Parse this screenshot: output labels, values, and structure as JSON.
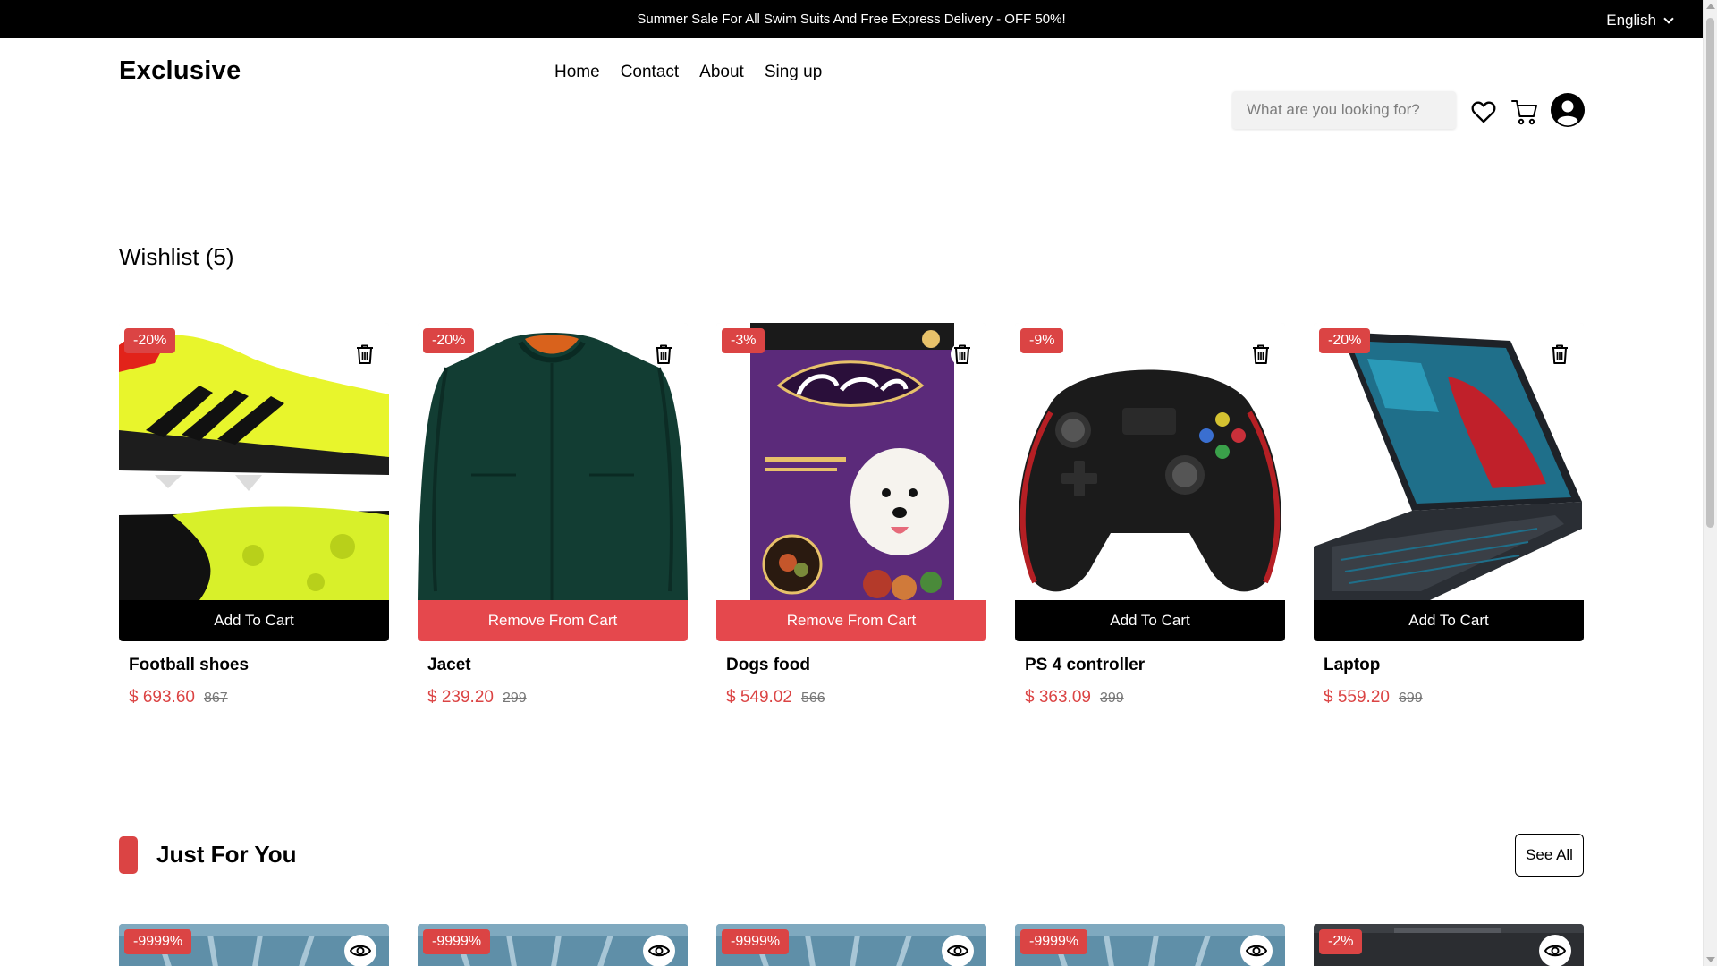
{
  "topbar": {
    "promo": "Summer Sale For All Swim Suits And Free Express Delivery - OFF 50%!",
    "language": "English"
  },
  "header": {
    "logo": "Exclusive",
    "nav": [
      "Home",
      "Contact",
      "About",
      "Sing up"
    ],
    "search_placeholder": "What are you looking for?"
  },
  "wishlist": {
    "title": "Wishlist (5)",
    "items": [
      {
        "discount": "-20%",
        "action": "Add To Cart",
        "action_style": "black",
        "name": "Football shoes",
        "price": "$ 693.60",
        "old_price": "867",
        "image": "football-shoes"
      },
      {
        "discount": "-20%",
        "action": "Remove From Cart",
        "action_style": "red",
        "name": "Jacet",
        "price": "$ 239.20",
        "old_price": "299",
        "image": "jacket"
      },
      {
        "discount": "-3%",
        "action": "Remove From Cart",
        "action_style": "red",
        "name": "Dogs food",
        "price": "$ 549.02",
        "old_price": "566",
        "image": "dog-food"
      },
      {
        "discount": "-9%",
        "action": "Add To Cart",
        "action_style": "black",
        "name": "PS 4 controller",
        "price": "$ 363.09",
        "old_price": "399",
        "image": "controller"
      },
      {
        "discount": "-20%",
        "action": "Add To Cart",
        "action_style": "black",
        "name": "Laptop",
        "price": "$ 559.20",
        "old_price": "699",
        "image": "laptop"
      }
    ]
  },
  "just_for_you": {
    "title": "Just For You",
    "see_all": "See All",
    "items": [
      {
        "discount": "-9999%"
      },
      {
        "discount": "-9999%"
      },
      {
        "discount": "-9999%"
      },
      {
        "discount": "-9999%"
      },
      {
        "discount": "-2%"
      }
    ]
  },
  "colors": {
    "accent": "#db4444",
    "remove_button": "#e5484d",
    "topbar": "#000000"
  },
  "icons": {
    "wishlist": "heart-icon",
    "cart": "cart-icon",
    "account": "user-icon",
    "delete": "trash-icon",
    "view": "eye-icon",
    "language": "chevron-down-icon"
  }
}
